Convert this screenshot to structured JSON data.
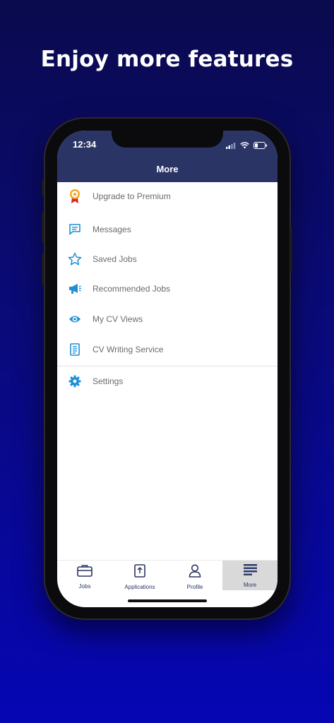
{
  "headline": "Enjoy more features",
  "status_bar": {
    "time": "12:34"
  },
  "nav": {
    "title": "More"
  },
  "menu": [
    {
      "label": "Upgrade to Premium",
      "icon": "medal-icon"
    },
    {
      "label": "Messages",
      "icon": "chat-icon"
    },
    {
      "label": "Saved Jobs",
      "icon": "star-icon"
    },
    {
      "label": "Recommended Jobs",
      "icon": "megaphone-icon"
    },
    {
      "label": "My CV Views",
      "icon": "eye-icon"
    },
    {
      "label": "CV Writing Service",
      "icon": "document-icon"
    },
    {
      "label": "Settings",
      "icon": "gear-icon"
    }
  ],
  "tabs": [
    {
      "label": "Jobs",
      "icon": "briefcase-icon"
    },
    {
      "label": "Applications",
      "icon": "upload-document-icon"
    },
    {
      "label": "Profile",
      "icon": "person-icon"
    },
    {
      "label": "More",
      "icon": "menu-lines-icon",
      "active": true
    }
  ],
  "colors": {
    "nav_bg": "#2a3566",
    "icon_blue": "#1f8fd6",
    "medal_orange": "#f2a623",
    "medal_red": "#d8262b",
    "active_tab_bg": "#d9d9d9"
  }
}
